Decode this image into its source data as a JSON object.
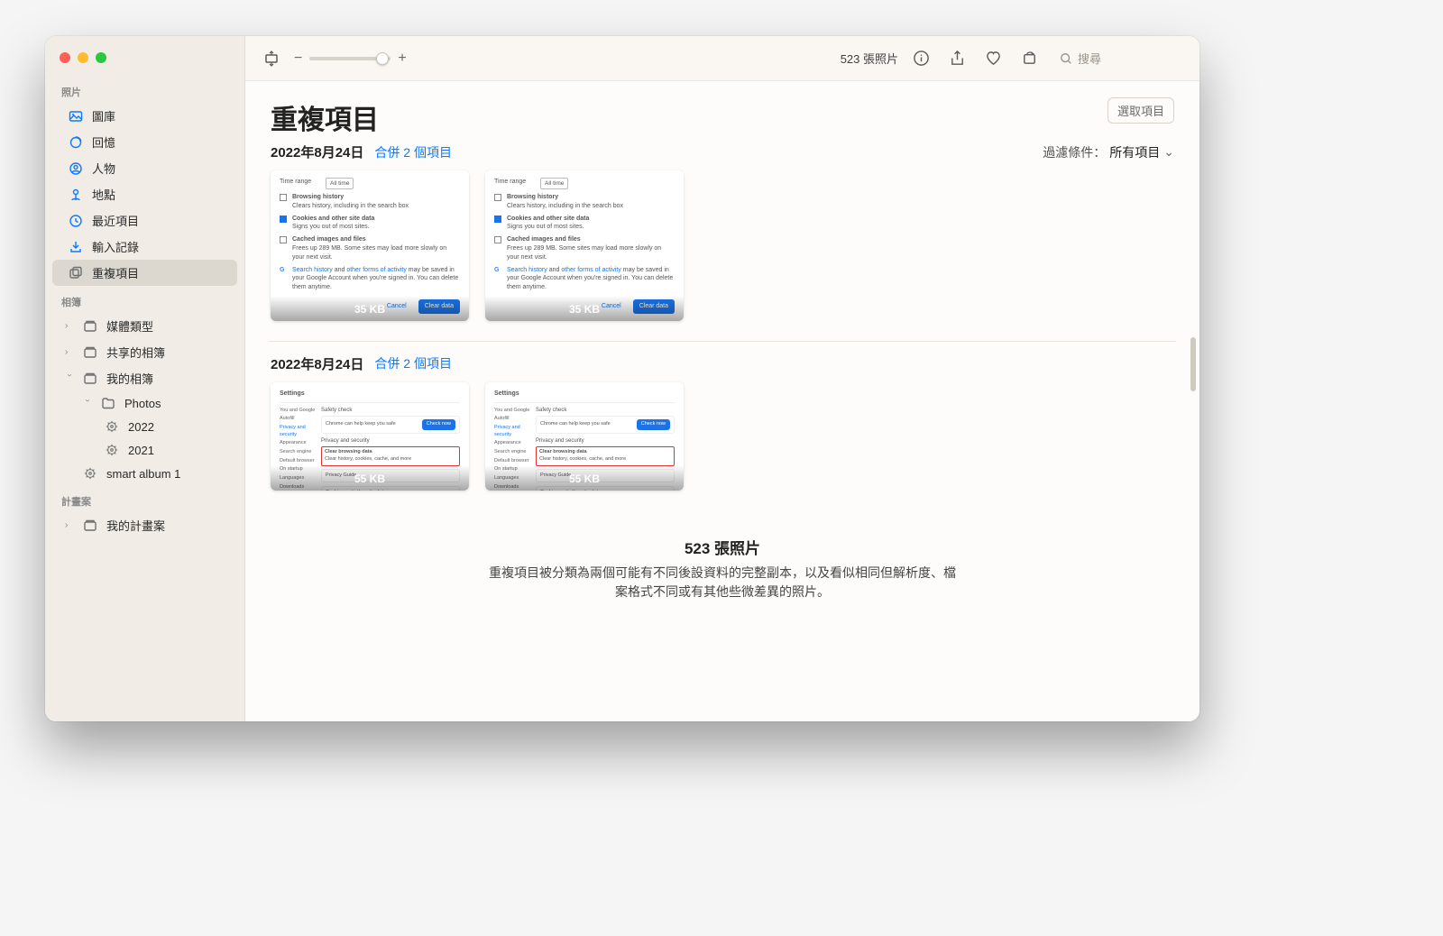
{
  "toolbar": {
    "photo_count": "523 張照片",
    "search_placeholder": "搜尋"
  },
  "sidebar": {
    "sections": {
      "photos_label": "照片",
      "albums_label": "相簿",
      "projects_label": "計畫案"
    },
    "library": "圖庫",
    "memories": "回憶",
    "people": "人物",
    "places": "地點",
    "recents": "最近項目",
    "imports": "輸入記錄",
    "duplicates": "重複項目",
    "media_types": "媒體類型",
    "shared_albums": "共享的相簿",
    "my_albums": "我的相簿",
    "folder_photos": "Photos",
    "album_2022": "2022",
    "album_2021": "2021",
    "smart_album": "smart album 1",
    "my_projects": "我的計畫案"
  },
  "header": {
    "title": "重複項目",
    "select_button": "選取項目"
  },
  "filter": {
    "label": "過濾條件：",
    "value": "所有項目"
  },
  "groups": [
    {
      "date": "2022年8月24日",
      "merge_label": "合併 2 個項目",
      "thumbs": [
        {
          "size": "35 KB"
        },
        {
          "size": "35 KB"
        }
      ]
    },
    {
      "date": "2022年8月24日",
      "merge_label": "合併 2 個項目",
      "thumbs": [
        {
          "size": "55 KB"
        },
        {
          "size": "55 KB"
        }
      ]
    }
  ],
  "footer": {
    "count": "523 張照片",
    "desc": "重複項目被分類為兩個可能有不同後設資料的完整副本，以及看似相同但解析度、檔案格式不同或有其他些微差異的照片。"
  },
  "thumb_content": {
    "time_range": "Time range",
    "all_time": "All time",
    "browsing_history": "Browsing history",
    "browsing_sub": "Clears history, including in the search box",
    "cookies": "Cookies and other site data",
    "cookies_sub": "Signs you out of most sites.",
    "cached": "Cached images and files",
    "cached_sub": "Frees up 289 MB. Some sites may load more slowly on your next visit.",
    "search_history": "Search history",
    "other_forms": "other forms of activity",
    "google_note": " may be saved in your Google Account when you're signed in. You can delete them anytime.",
    "cancel": "Cancel",
    "clear_data": "Clear data",
    "settings": "Settings",
    "safety_check": "Safety check",
    "check_now": "Check now",
    "privacy_security": "Privacy and security",
    "clear_browsing": "Clear browsing data"
  }
}
